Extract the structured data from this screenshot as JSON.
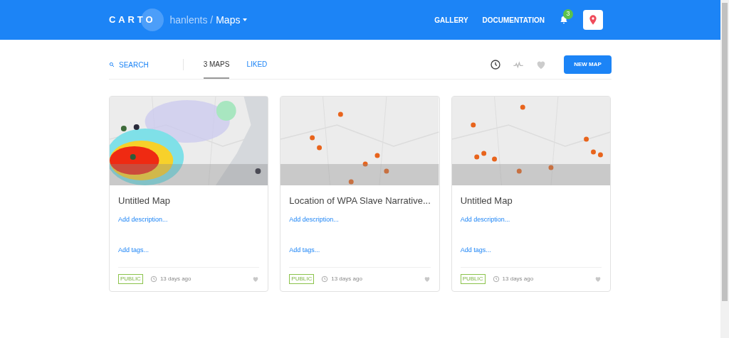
{
  "header": {
    "logo": "CARTO",
    "user": "hanlents /",
    "section": "Maps",
    "nav": [
      "GALLERY",
      "DOCUMENTATION"
    ],
    "notifications": "3"
  },
  "toolbar": {
    "search": "SEARCH",
    "tabs": [
      {
        "label": "3 MAPS",
        "selected": true
      },
      {
        "label": "LIKED",
        "selected": false
      }
    ],
    "new_map": "NEW MAP"
  },
  "cards": [
    {
      "kind": "heatmap",
      "title": "Untitled Map",
      "description": "Add description...",
      "tags": "Add tags...",
      "privacy": "PUBLIC",
      "time": "13 days ago",
      "liked": false
    },
    {
      "kind": "points",
      "title": "Location of WPA Slave Narrative...",
      "description": "Add description...",
      "tags": "Add tags...",
      "privacy": "PUBLIC",
      "time": "13 days ago",
      "liked": false
    },
    {
      "kind": "points",
      "title": "Untitled Map",
      "description": "Add description...",
      "tags": "Add tags...",
      "privacy": "PUBLIC",
      "time": "13 days ago",
      "liked": false
    }
  ]
}
